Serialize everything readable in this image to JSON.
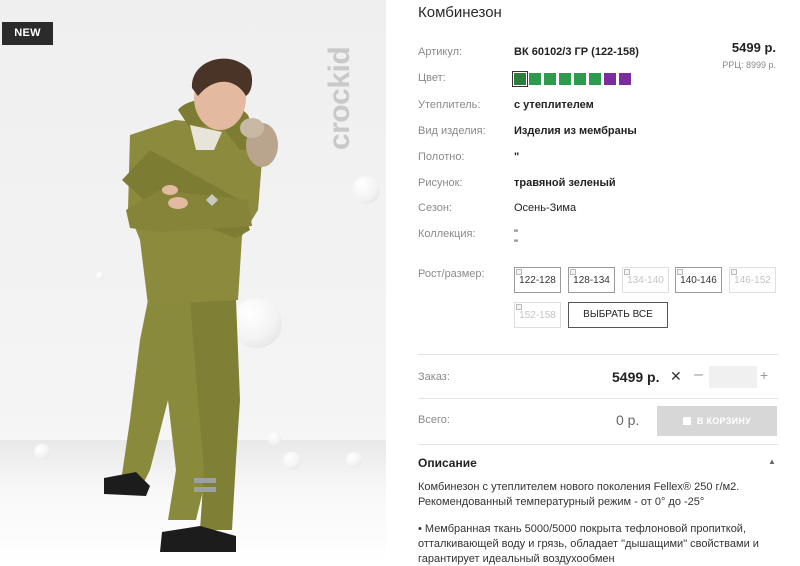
{
  "image": {
    "badge": "NEW",
    "brand_logo": "crockid",
    "alt": "Мальчик в оливковом зимнем комбинезоне с меховой опушкой капюшона"
  },
  "product": {
    "title": "Комбинезон",
    "price": "5499 р.",
    "rrp": "РРЦ: 8999 р.",
    "attributes": [
      {
        "label": "Артикул:",
        "value": "ВК 60102/3 ГР (122-158)"
      },
      {
        "label": "Цвет:",
        "value": ""
      },
      {
        "label": "Утеплитель:",
        "value": "с утеплителем"
      },
      {
        "label": "Вид изделия:",
        "value": "Изделия из мембраны"
      },
      {
        "label": "Полотно:",
        "value": "\""
      },
      {
        "label": "Рисунок:",
        "value": "травяной зеленый"
      },
      {
        "label": "Сезон:",
        "value": "Осень-Зима"
      },
      {
        "label": "Коллекция:",
        "value": "\""
      },
      {
        "label": "Рост/размер:",
        "value": ""
      }
    ],
    "collection_extra": "\"",
    "colors": [
      "#2e7d3e",
      "#2e9a4e",
      "#2e9a4e",
      "#2e9a4e",
      "#2e9a4e",
      "#2e9a4e",
      "#7b2da0",
      "#7b2da0"
    ],
    "sizes": [
      {
        "label": "122-128",
        "available": true
      },
      {
        "label": "128-134",
        "available": true
      },
      {
        "label": "134-140",
        "available": false
      },
      {
        "label": "140-146",
        "available": true
      },
      {
        "label": "146-152",
        "available": false
      },
      {
        "label": "152-158",
        "available": false
      }
    ],
    "select_all_label": "ВЫБРАТЬ ВСЕ"
  },
  "order": {
    "label": "Заказ:",
    "price": "5499 р.",
    "remove_symbol": "✕",
    "minus": "–",
    "quantity": "",
    "plus": "+"
  },
  "total": {
    "label": "Всего:",
    "value": "0 р.",
    "cart_button": "В КОРЗИНУ"
  },
  "description": {
    "title": "Описание",
    "caret": "▲",
    "paragraphs": [
      "Комбинезон с утеплителем нового поколения Fellex® 250 г/м2. Рекомендованный температурный режим - от 0° до -25°",
      "• Мембранная ткань 5000/5000 покрыта тефлоновой пропиткой, отталкивающей воду и грязь, обладает \"дышащими\" свойствами и гарантирует идеальный воздухообмен"
    ]
  }
}
